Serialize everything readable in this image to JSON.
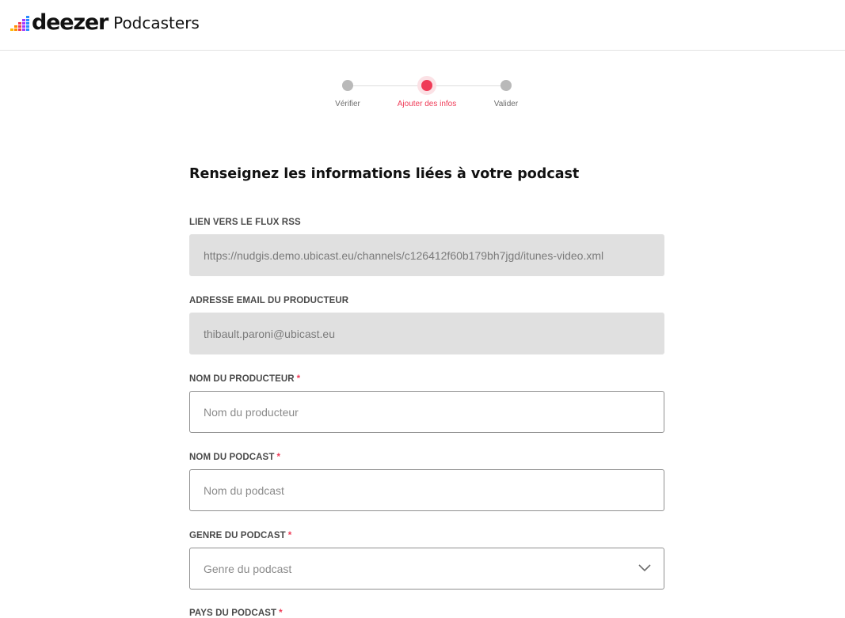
{
  "header": {
    "brand": "deezer",
    "product": "Podcasters"
  },
  "stepper": {
    "steps": [
      {
        "label": "Vérifier",
        "state": "inactive"
      },
      {
        "label": "Ajouter des infos",
        "state": "active"
      },
      {
        "label": "Valider",
        "state": "inactive"
      }
    ]
  },
  "form": {
    "title": "Renseignez les informations liées à votre podcast",
    "rss": {
      "label": "LIEN VERS LE FLUX RSS",
      "value": "https://nudgis.demo.ubicast.eu/channels/c126412f60b179bh7jgd/itunes-video.xml"
    },
    "email": {
      "label": "ADRESSE EMAIL DU PRODUCTEUR",
      "value": "thibault.paroni@ubicast.eu"
    },
    "producer_name": {
      "label": "NOM DU PRODUCTEUR",
      "required": "*",
      "placeholder": "Nom du producteur"
    },
    "podcast_name": {
      "label": "NOM DU PODCAST",
      "required": "*",
      "placeholder": "Nom du podcast"
    },
    "podcast_genre": {
      "label": "GENRE DU PODCAST",
      "required": "*",
      "placeholder": "Genre du podcast"
    },
    "podcast_country": {
      "label": "PAYS DU PODCAST",
      "required": "*"
    }
  },
  "colors": {
    "accent": "#ef3b57",
    "inactive_step": "#b9b9b9",
    "readonly_bg": "#e0e0e0"
  }
}
